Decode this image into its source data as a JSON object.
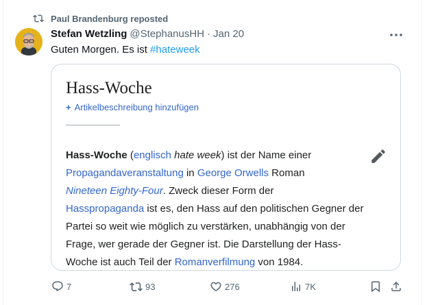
{
  "repost": {
    "text": "Paul Brandenburg reposted",
    "icon": "repost-icon"
  },
  "author": {
    "name": "Stefan Wetzling",
    "handle": "@StephanusHH",
    "separator": "·",
    "date": "Jan 20"
  },
  "tweet": {
    "text": "Guten Morgen. Es ist ",
    "hashtag": "#hateweek"
  },
  "card": {
    "title": "Hass-Woche",
    "add_plus": "+",
    "add_description": "Artikelbeschreibung hinzufügen",
    "lines": [
      [
        {
          "t": "Hass-Woche",
          "s": "b"
        },
        {
          "t": " (",
          "s": ""
        },
        {
          "t": "englisch",
          "s": "lk"
        },
        {
          "t": " ",
          "s": ""
        },
        {
          "t": "hate week",
          "s": "i"
        },
        {
          "t": ") ist der Name einer",
          "s": ""
        }
      ],
      [
        {
          "t": "Propagandaveranstaltung",
          "s": "lk"
        },
        {
          "t": " in ",
          "s": ""
        },
        {
          "t": "George Orwells",
          "s": "lk"
        },
        {
          "t": " Roman",
          "s": ""
        }
      ],
      [
        {
          "t": "Nineteen Eighty-Four",
          "s": "lk i"
        },
        {
          "t": ". Zweck dieser Form der",
          "s": ""
        }
      ],
      [
        {
          "t": "Hasspropaganda",
          "s": "lk"
        },
        {
          "t": " ist es, den Hass auf den politischen Gegner der",
          "s": ""
        }
      ],
      [
        {
          "t": "Partei so weit wie möglich zu verstärken, unabhängig von der",
          "s": ""
        }
      ],
      [
        {
          "t": "Frage, wer gerade der Gegner ist. Die Darstellung der Hass-",
          "s": ""
        }
      ],
      [
        {
          "t": "Woche ist auch Teil der ",
          "s": ""
        },
        {
          "t": "Romanverfilmung",
          "s": "lk"
        },
        {
          "t": " von 1984.",
          "s": ""
        }
      ]
    ]
  },
  "actions": {
    "replies": "7",
    "reposts": "93",
    "likes": "276",
    "views": "7K"
  },
  "colors": {
    "text": "#0f1419",
    "muted": "#536471",
    "link": "#1d9bf0",
    "wiki_link": "#3366cc",
    "card_border": "#cfd9de"
  }
}
